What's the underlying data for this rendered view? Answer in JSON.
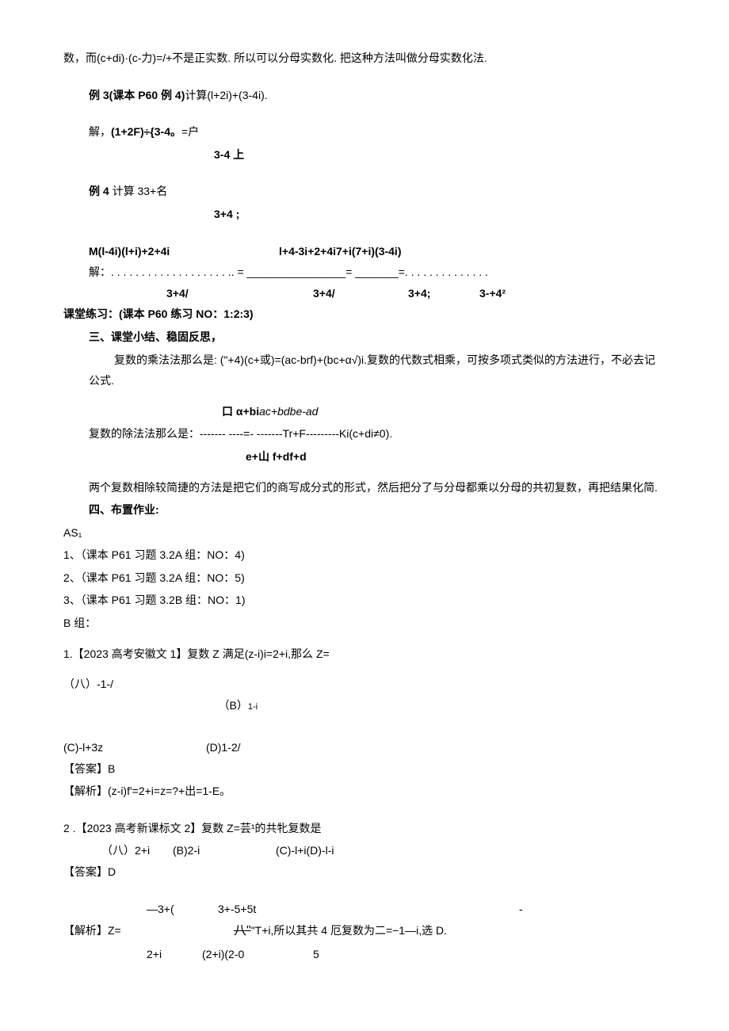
{
  "p1": "数，而(c+di)·(c-力)=/+不是正实数. 所以可以分母实数化. 把这种方法叫做分母实数化法.",
  "p2": "例 3(课本 P60 例 4)",
  "p2b": "计算(l+2i)+(3-4i).",
  "p3a": "解，",
  "p3b": "(1+2F)÷{3-4。",
  "p3c": "=户",
  "p4": "3-4 上",
  "p5a": "例 4 ",
  "p5b": "计算 33+名",
  "p6": "3+4 ;",
  "p7a": "M(l-4i)(l+i)+2+4i",
  "p7b": "l+4-3i+2+4i7+i(7+i)(3-4i)",
  "p8a": "解：",
  "p8dots": ". . . . . . . . . . . . . . . . . . . .",
  "p8eq": ". = ________________= _______=",
  "p8dots2": ". . . . . . . . . . . . . .",
  "p9a": "3+4/",
  "p9b": "3+4/",
  "p9c": "3+4;",
  "p9d": "3-+4²",
  "p10": "课堂练习：(课本 P60 练习 NO：1:2:3)",
  "p11": "三、课堂小结、稳固反思，",
  "p12": "复数的乘法法那么是: (\"+4)(c+或)=(ac-brf)+(bc+α√)i.复数的代数式相乘，可按多项式类似的方法进行，不必去记公式.",
  "p13": "口 α+bi",
  "p13i": "ac+bdbe-ad",
  "p14a": "复数的除法法那么是：",
  "p14b": "------- ----=- -------Tr+F---------Ki(c+di≠0).",
  "p15": "e+山 f+df+d",
  "p16": "两个复数相除较简捷的方法是把它们的商写成分式的形式，然后把分了与分母都乘以分母的共初复数，再把结果化简.",
  "p17": "四、布置作业:",
  "p18": "AS₁",
  "p19": "1、（课本 P61 习题 3.2A 组：NO：4)",
  "p20": "2、（课本 P61 习题 3.2A 组：NO：5)",
  "p21": "3、（课本 P61 习题 3.2B 组：NO：1)",
  "p22": "B 组：",
  "p23": "1.【2023 高考安徽文 1】复数 Z 满足(z-i)i=2+i,那么 Z=",
  "p24a": "（八）-1-/",
  "p24b": "（B）",
  "p24bi": "1-i",
  "p25a": "(C)-l+3z",
  "p25b": "(D)1-2/",
  "p26": "【答案】B",
  "p27": "【解析】(z-i)f'=2+i=z=?+出=1-E。",
  "p28": "2 .【2023 高考新课标文 2】复数 Z=芸¹的共牝复数是",
  "p29a": "（八）2+i",
  "p29b": "(B)2-i",
  "p29c": "(C)-l+i(D)-l-i",
  "p30": "【答案】D",
  "p31a": "—3+(",
  "p31b": "3+-5+5t",
  "p31c": "-",
  "p32a": "【解析】Z=",
  "p32b": "八\"",
  "p32c": "\"T+i,所以其共 4 厄复数为二=−1—i,选 D.",
  "p33a": "2+i",
  "p33b": "(2+i)(2-0",
  "p33c": "5"
}
